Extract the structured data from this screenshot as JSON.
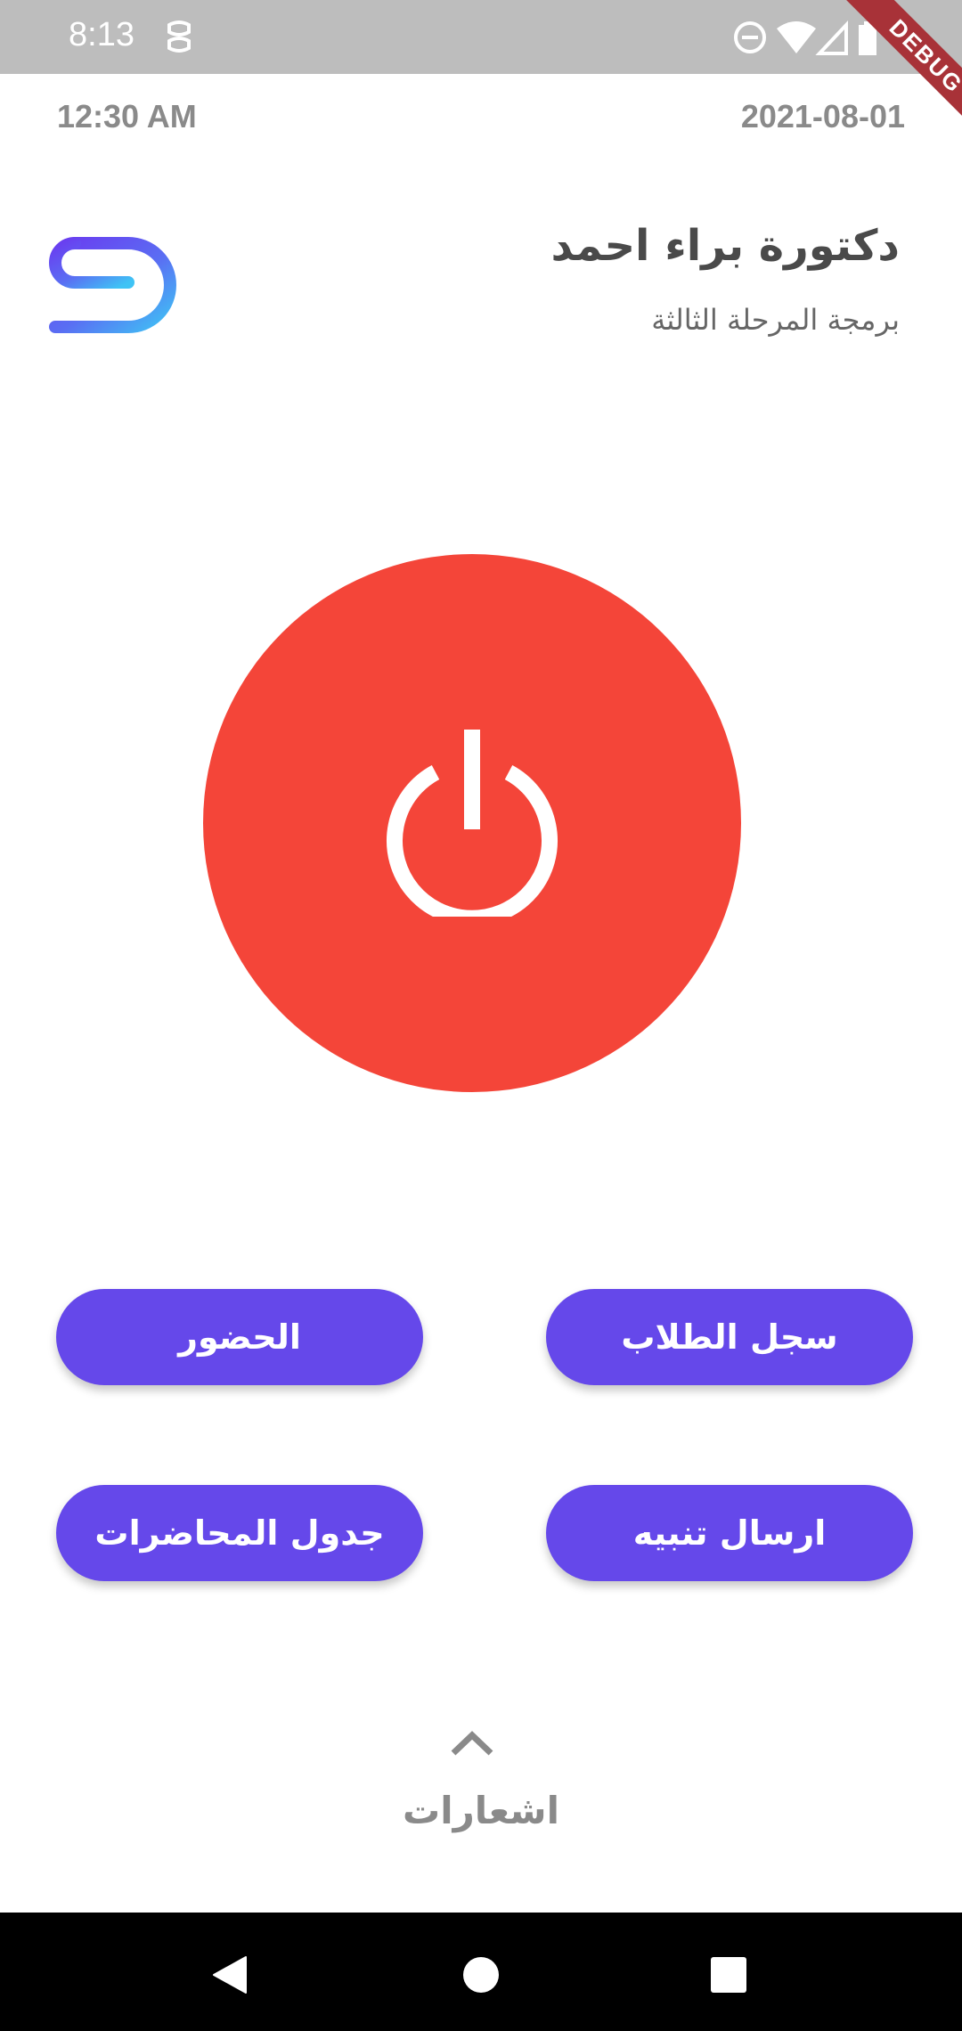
{
  "status_bar": {
    "time": "8:13",
    "icons": [
      "notification-icon",
      "dnd-icon",
      "wifi-icon",
      "signal-icon",
      "battery-icon"
    ],
    "debug_label": "DEBUG"
  },
  "header": {
    "time": "12:30 AM",
    "date": "2021-08-01"
  },
  "profile": {
    "name": "دكتورة براء احمد",
    "stage": "برمجة المرحلة الثالثة"
  },
  "power": {
    "icon": "power-icon",
    "color": "#f44539"
  },
  "actions": {
    "attendance": "الحضور",
    "student_records": "سجل الطلاب",
    "lecture_schedule": "جدول المحاضرات",
    "send_alert": "ارسال تنبيه",
    "color": "#6548ea"
  },
  "notifications": {
    "label": "اشعارات",
    "icon": "chevron-up-icon"
  },
  "nav_bar": {
    "icons": [
      "back-icon",
      "home-icon",
      "recents-icon"
    ]
  }
}
